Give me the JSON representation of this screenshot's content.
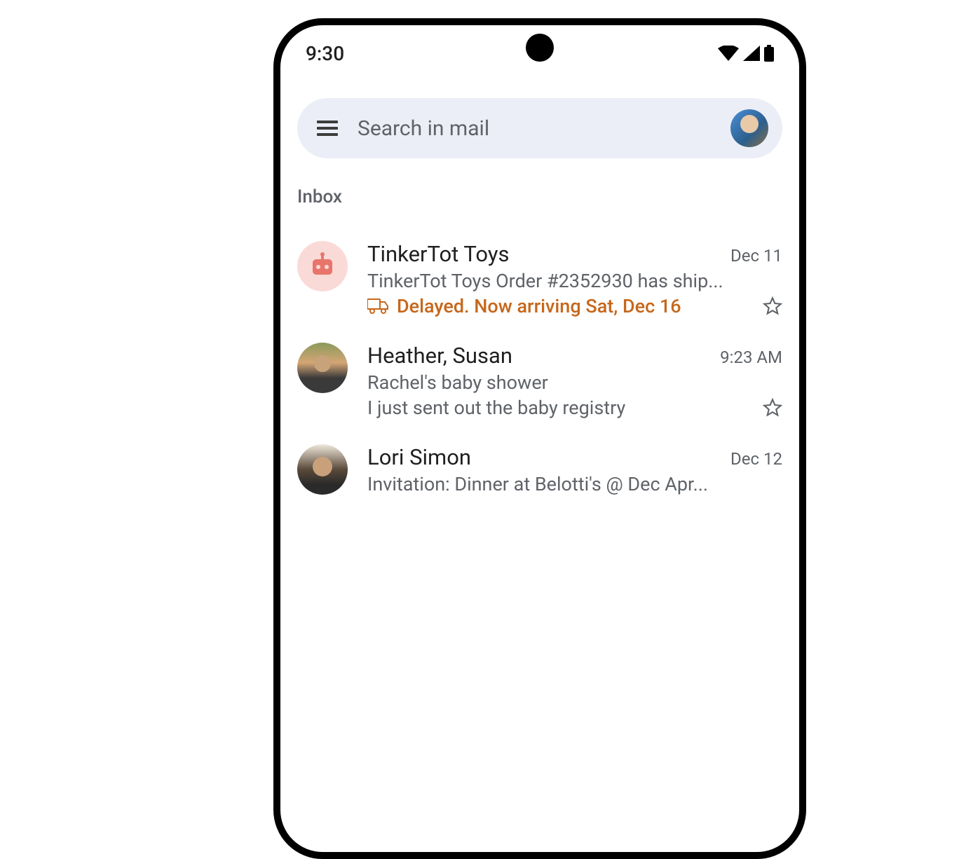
{
  "status": {
    "time": "9:30"
  },
  "search": {
    "placeholder": "Search in mail"
  },
  "section": {
    "label": "Inbox"
  },
  "emails": [
    {
      "sender": "TinkerTot Toys",
      "date": "Dec 11",
      "subject": "TinkerTot Toys Order #2352930 has ship...",
      "delay": "Delayed. Now arriving Sat, Dec 16"
    },
    {
      "sender": "Heather, Susan",
      "date": "9:23 AM",
      "subject": "Rachel's baby shower",
      "snippet": "I just sent out the baby registry"
    },
    {
      "sender": "Lori Simon",
      "date": "Dec 12",
      "subject": "Invitation: Dinner at Belotti's @ Dec Apr..."
    }
  ]
}
